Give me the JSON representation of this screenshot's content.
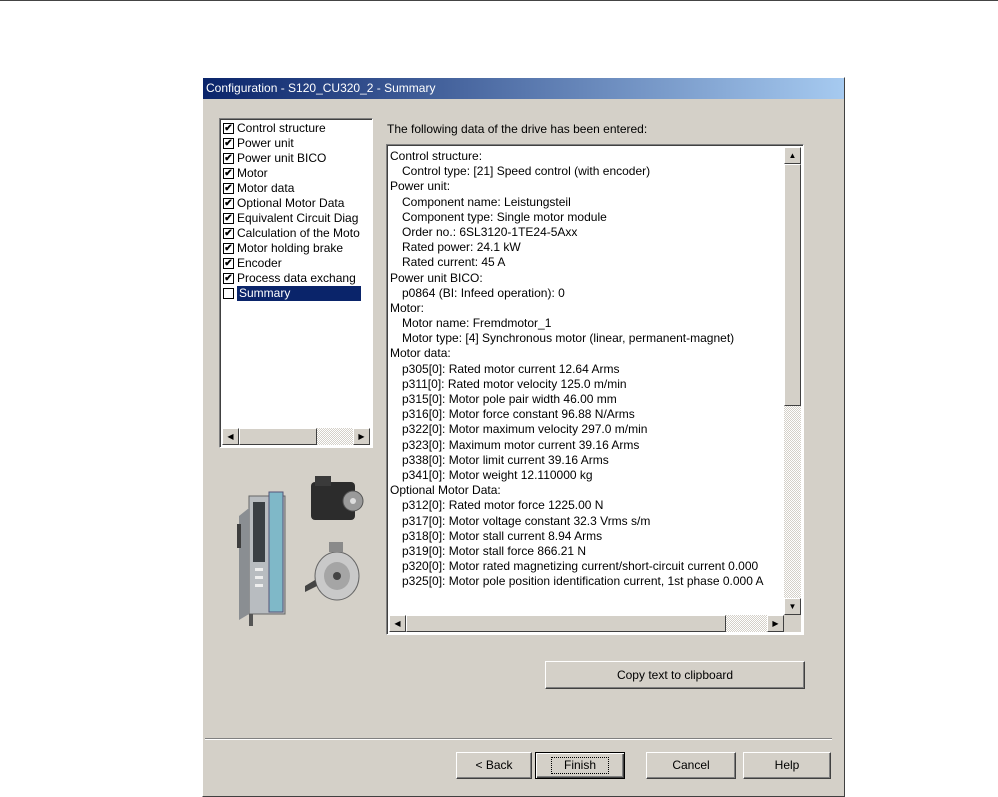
{
  "window": {
    "title": "Configuration - S120_CU320_2 - Summary"
  },
  "tree": {
    "items": [
      {
        "label": "Control structure",
        "checked": true,
        "selected": false
      },
      {
        "label": "Power unit",
        "checked": true,
        "selected": false
      },
      {
        "label": "Power unit BICO",
        "checked": true,
        "selected": false
      },
      {
        "label": "Motor",
        "checked": true,
        "selected": false
      },
      {
        "label": "Motor data",
        "checked": true,
        "selected": false
      },
      {
        "label": "Optional Motor Data",
        "checked": true,
        "selected": false
      },
      {
        "label": "Equivalent Circuit Diag",
        "checked": true,
        "selected": false
      },
      {
        "label": "Calculation of the Moto",
        "checked": true,
        "selected": false
      },
      {
        "label": "Motor holding brake",
        "checked": true,
        "selected": false
      },
      {
        "label": "Encoder",
        "checked": true,
        "selected": false
      },
      {
        "label": "Process data exchang",
        "checked": true,
        "selected": false
      },
      {
        "label": "Summary",
        "checked": false,
        "selected": true
      }
    ]
  },
  "summary": {
    "heading": "The following data of the drive has been entered:",
    "lines": [
      {
        "text": "Control structure:",
        "indent": false
      },
      {
        "text": "Control type: [21] Speed control (with encoder)",
        "indent": true
      },
      {
        "text": "Power unit:",
        "indent": false
      },
      {
        "text": "Component name: Leistungsteil",
        "indent": true
      },
      {
        "text": "Component type: Single motor module",
        "indent": true
      },
      {
        "text": "Order no.: 6SL3120-1TE24-5Axx",
        "indent": true
      },
      {
        "text": "Rated power: 24.1 kW",
        "indent": true
      },
      {
        "text": "Rated current: 45 A",
        "indent": true
      },
      {
        "text": "Power unit BICO:",
        "indent": false
      },
      {
        "text": "p0864 (BI: Infeed operation): 0",
        "indent": true
      },
      {
        "text": "Motor:",
        "indent": false
      },
      {
        "text": "Motor name: Fremdmotor_1",
        "indent": true
      },
      {
        "text": "Motor type: [4] Synchronous motor (linear, permanent-magnet)",
        "indent": true
      },
      {
        "text": "Motor data:",
        "indent": false
      },
      {
        "text": "p305[0]: Rated motor current 12.64 Arms",
        "indent": true
      },
      {
        "text": "p311[0]: Rated motor velocity 125.0 m/min",
        "indent": true
      },
      {
        "text": "p315[0]: Motor pole pair width 46.00 mm",
        "indent": true
      },
      {
        "text": "p316[0]: Motor force constant 96.88 N/Arms",
        "indent": true
      },
      {
        "text": "p322[0]: Motor maximum velocity 297.0 m/min",
        "indent": true
      },
      {
        "text": "p323[0]: Maximum motor current 39.16 Arms",
        "indent": true
      },
      {
        "text": "p338[0]: Motor limit current 39.16 Arms",
        "indent": true
      },
      {
        "text": "p341[0]: Motor weight 12.110000 kg",
        "indent": true
      },
      {
        "text": "Optional Motor Data:",
        "indent": false
      },
      {
        "text": "p312[0]: Rated motor force 1225.00 N",
        "indent": true
      },
      {
        "text": "p317[0]: Motor voltage constant 32.3 Vrms s/m",
        "indent": true
      },
      {
        "text": "p318[0]: Motor stall current 8.94 Arms",
        "indent": true
      },
      {
        "text": "p319[0]: Motor stall force 866.21 N",
        "indent": true
      },
      {
        "text": "p320[0]: Motor rated magnetizing current/short-circuit current 0.000",
        "indent": true
      },
      {
        "text": "p325[0]: Motor pole position identification current, 1st phase 0.000 A",
        "indent": true
      }
    ]
  },
  "buttons": {
    "copy": "Copy text to clipboard",
    "back": "< Back",
    "finish": "Finish",
    "cancel": "Cancel",
    "help": "Help"
  },
  "icons": {
    "scroll_left": "scroll-left-arrow-icon",
    "scroll_right": "scroll-right-arrow-icon",
    "scroll_up": "scroll-up-arrow-icon",
    "scroll_down": "scroll-down-arrow-icon",
    "illustration": "drive-hardware-illustration"
  }
}
